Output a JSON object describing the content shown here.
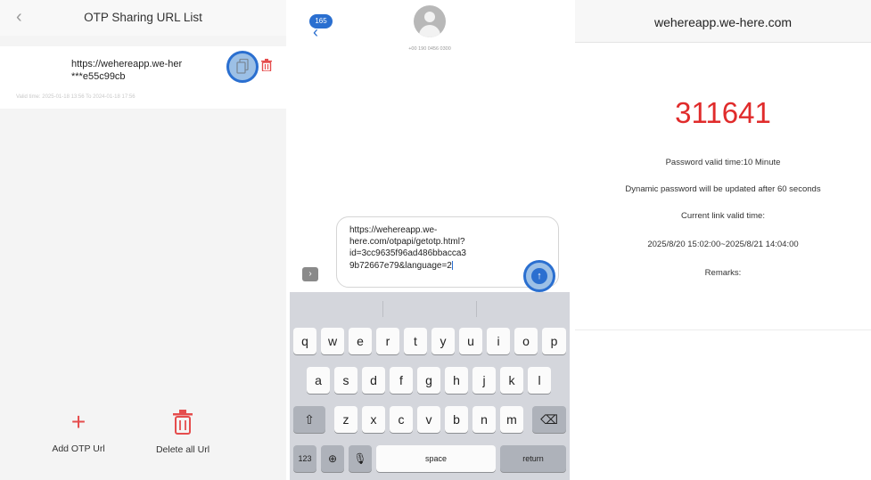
{
  "otp_list": {
    "title": "OTP Sharing URL List",
    "back_icon": "chevron-left-icon",
    "item": {
      "url_line1": "https://wehereapp.we-her",
      "url_line2": "***e55c99cb",
      "valid_time": "Valid time: 2025-01-18 13:56 To 2024-01-18 17:56"
    },
    "add_label": "Add OTP Url",
    "delete_label": "Delete all Url",
    "accent": "#e54d4d"
  },
  "messages": {
    "unread_count": "165",
    "phone": "+00 190 0456 0300",
    "message_lines": [
      "https://wehereapp.we-",
      "here.com/otpapi/getotp.html?",
      "id=3cc9635f96ad486bbacca3",
      "9b72667e79&language=2"
    ],
    "keyboard": {
      "row1": [
        "q",
        "w",
        "e",
        "r",
        "t",
        "y",
        "u",
        "i",
        "o",
        "p"
      ],
      "row2": [
        "a",
        "s",
        "d",
        "f",
        "g",
        "h",
        "j",
        "k",
        "l"
      ],
      "row3": [
        "z",
        "x",
        "c",
        "v",
        "b",
        "n",
        "m"
      ],
      "numbers": "123",
      "space": "space",
      "return": "return"
    },
    "accent": "#2a6fd0"
  },
  "password_page": {
    "domain": "wehereapp.we-here.com",
    "code": "311641",
    "valid_time": "Password valid time:10 Minute",
    "update_note": "Dynamic password will be updated after 60 seconds",
    "link_label": "Current link valid time:",
    "link_range": "2025/8/20 15:02:00~2025/8/21 14:04:00",
    "remarks": "Remarks:",
    "code_color": "#e02b2b"
  }
}
